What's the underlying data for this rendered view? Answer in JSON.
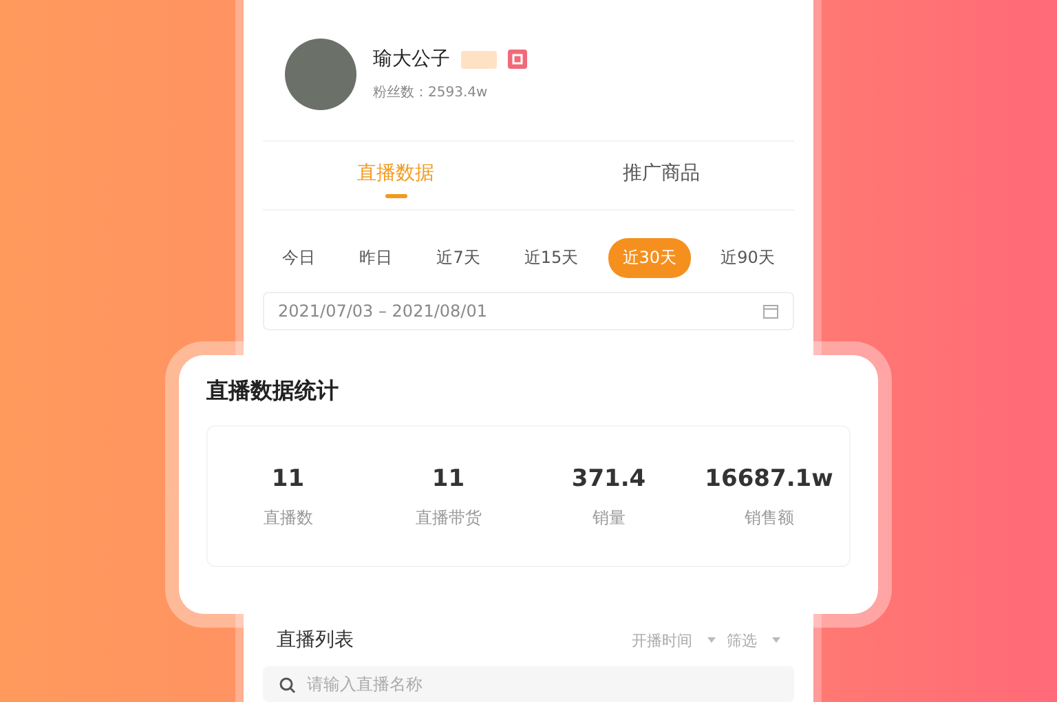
{
  "profile": {
    "name": "瑜大公子",
    "fans": "粉丝数：2593.4w"
  },
  "tabs": [
    {
      "label": "直播数据",
      "selected": true
    },
    {
      "label": "推广商品",
      "selected": false
    }
  ],
  "ranges": [
    {
      "label": "今日",
      "selected": false
    },
    {
      "label": "昨日",
      "selected": false
    },
    {
      "label": "近7天",
      "selected": false
    },
    {
      "label": "近15天",
      "selected": false
    },
    {
      "label": "近30天",
      "selected": true
    },
    {
      "label": "近90天",
      "selected": false
    }
  ],
  "date_range": "2021/07/03 – 2021/08/01",
  "stats_card": {
    "title": "直播数据统计",
    "stats": [
      {
        "value": "11",
        "label": "直播数"
      },
      {
        "value": "11",
        "label": "直播带货"
      },
      {
        "value": "371.4",
        "label": "销量"
      },
      {
        "value": "16687.1w",
        "label": "销售额"
      }
    ]
  },
  "list": {
    "title": "直播列表",
    "sort": "开播时间",
    "filter": "筛选",
    "search": {
      "placeholder": "请输入直播名称"
    }
  }
}
